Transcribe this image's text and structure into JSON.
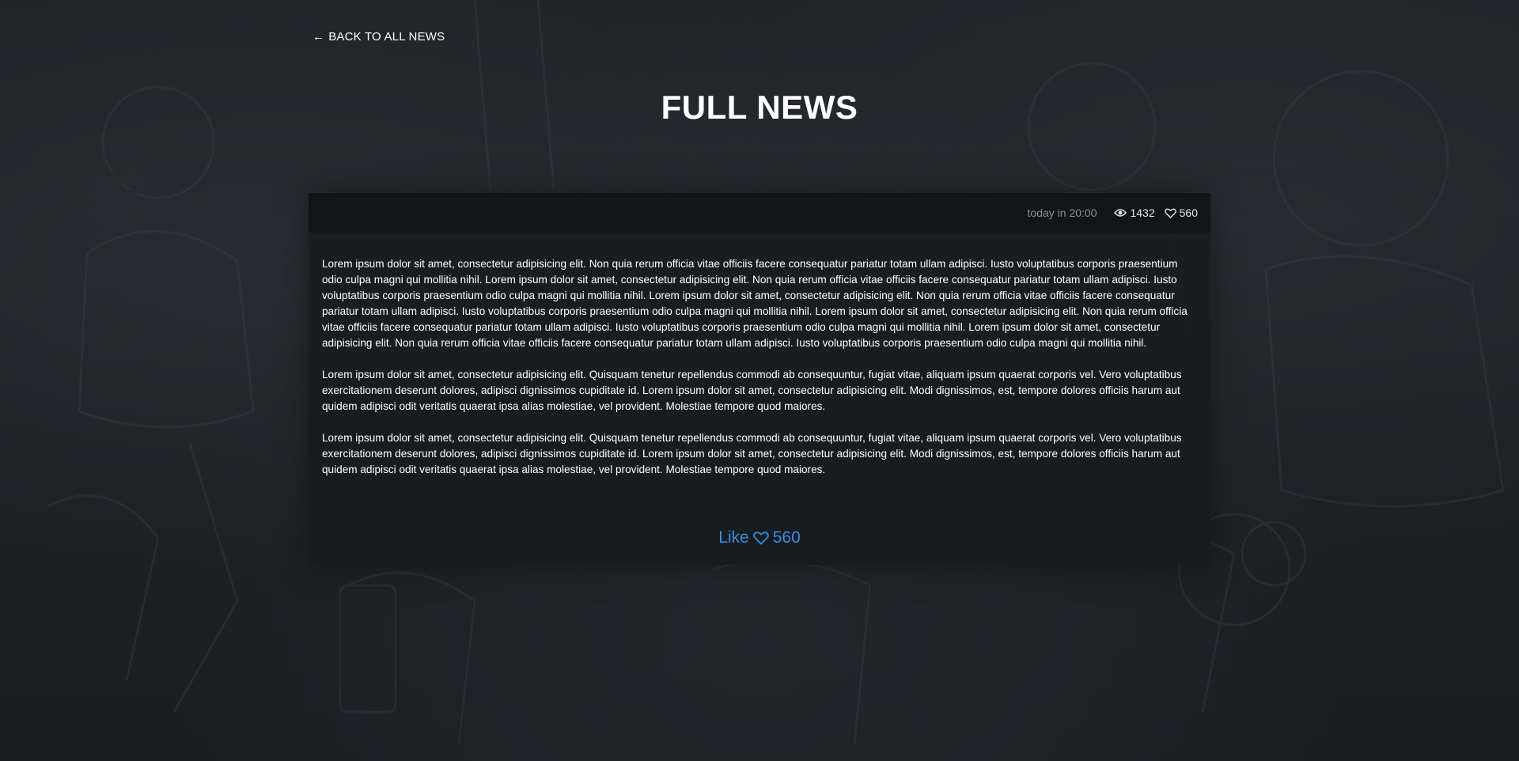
{
  "nav": {
    "back_label": "BACK TO ALL NEWS"
  },
  "page": {
    "title": "FULL NEWS"
  },
  "article": {
    "date": "today in 20:00",
    "views": "1432",
    "likes": "560",
    "paragraphs": [
      "Lorem ipsum dolor sit amet, consectetur adipisicing elit. Non quia rerum officia vitae officiis facere consequatur pariatur totam ullam adipisci. Iusto voluptatibus corporis praesentium odio culpa magni qui mollitia nihil. Lorem ipsum dolor sit amet, consectetur adipisicing elit. Non quia rerum officia vitae officiis facere consequatur pariatur totam ullam adipisci. Iusto voluptatibus corporis praesentium odio culpa magni qui mollitia nihil. Lorem ipsum dolor sit amet, consectetur adipisicing elit. Non quia rerum officia vitae officiis facere consequatur pariatur totam ullam adipisci. Iusto voluptatibus corporis praesentium odio culpa magni qui mollitia nihil. Lorem ipsum dolor sit amet, consectetur adipisicing elit. Non quia rerum officia vitae officiis facere consequatur pariatur totam ullam adipisci. Iusto voluptatibus corporis praesentium odio culpa magni qui mollitia nihil. Lorem ipsum dolor sit amet, consectetur adipisicing elit. Non quia rerum officia vitae officiis facere consequatur pariatur totam ullam adipisci. Iusto voluptatibus corporis praesentium odio culpa magni qui mollitia nihil.",
      "Lorem ipsum dolor sit amet, consectetur adipisicing elit. Quisquam tenetur repellendus commodi ab consequuntur, fugiat vitae, aliquam ipsum quaerat corporis vel. Vero voluptatibus exercitationem deserunt dolores, adipisci dignissimos cupiditate id. Lorem ipsum dolor sit amet, consectetur adipisicing elit. Modi dignissimos, est, tempore dolores officiis harum aut quidem adipisci odit veritatis quaerat ipsa alias molestiae, vel provident. Molestiae tempore quod maiores.",
      "Lorem ipsum dolor sit amet, consectetur adipisicing elit. Quisquam tenetur repellendus commodi ab consequuntur, fugiat vitae, aliquam ipsum quaerat corporis vel. Vero voluptatibus exercitationem deserunt dolores, adipisci dignissimos cupiditate id. Lorem ipsum dolor sit amet, consectetur adipisicing elit. Modi dignissimos, est, tempore dolores officiis harum aut quidem adipisci odit veritatis quaerat ipsa alias molestiae, vel provident. Molestiae tempore quod maiores."
    ],
    "like_label": "Like",
    "like_count": "560"
  },
  "icons": {
    "back": "arrow-left-icon",
    "views": "eye-icon",
    "likes": "heart-icon"
  },
  "colors": {
    "background": "#1c1f22",
    "card": "#181b1e",
    "accent": "#2f8fe0",
    "text": "#ffffff",
    "muted": "#8c8f93"
  }
}
